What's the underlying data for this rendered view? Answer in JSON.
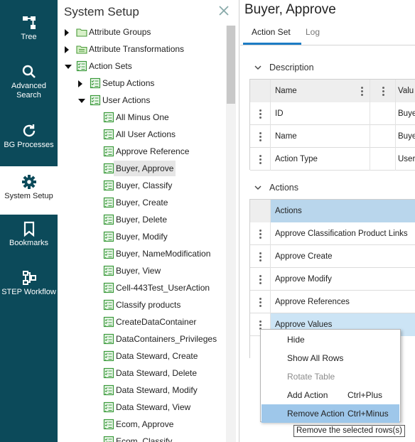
{
  "nav": {
    "items": [
      {
        "label": "Tree",
        "icon": "tree-icon"
      },
      {
        "label": "Advanced Search",
        "icon": "search-icon"
      },
      {
        "label": "BG Processes",
        "icon": "refresh-icon"
      },
      {
        "label": "System Setup",
        "icon": "gear-icon",
        "active": true
      },
      {
        "label": "Bookmarks",
        "icon": "bookmark-icon"
      },
      {
        "label": "STEP Workflow",
        "icon": "workflow-icon"
      }
    ]
  },
  "tree": {
    "title": "System Setup",
    "nodes": [
      {
        "label": "Attribute Groups",
        "state": "collapsed",
        "icon": "folder"
      },
      {
        "label": "Attribute Transformations",
        "state": "collapsed",
        "icon": "folder-list"
      },
      {
        "label": "Action Sets",
        "state": "expanded",
        "icon": "checklist"
      },
      {
        "label": "Setup Actions",
        "state": "collapsed",
        "icon": "checklist"
      },
      {
        "label": "User Actions",
        "state": "expanded",
        "icon": "checklist"
      },
      {
        "label": "All Minus One",
        "icon": "checklist"
      },
      {
        "label": "All User Actions",
        "icon": "checklist"
      },
      {
        "label": "Approve Reference",
        "icon": "checklist"
      },
      {
        "label": "Buyer, Approve",
        "icon": "checklist",
        "selected": true
      },
      {
        "label": "Buyer, Classify",
        "icon": "checklist"
      },
      {
        "label": "Buyer, Create",
        "icon": "checklist"
      },
      {
        "label": "Buyer, Delete",
        "icon": "checklist"
      },
      {
        "label": "Buyer, Modify",
        "icon": "checklist"
      },
      {
        "label": "Buyer, NameModification",
        "icon": "checklist"
      },
      {
        "label": "Buyer, View",
        "icon": "checklist"
      },
      {
        "label": "Cell-443Test_UserAction",
        "icon": "checklist"
      },
      {
        "label": "Classify products",
        "icon": "checklist"
      },
      {
        "label": "CreateDataContainer",
        "icon": "checklist"
      },
      {
        "label": "DataContainers_Privileges",
        "icon": "checklist"
      },
      {
        "label": "Data Steward, Create",
        "icon": "checklist"
      },
      {
        "label": "Data Steward, Delete",
        "icon": "checklist"
      },
      {
        "label": "Data Steward, Modify",
        "icon": "checklist"
      },
      {
        "label": "Data Steward, View",
        "icon": "checklist"
      },
      {
        "label": "Ecom, Approve",
        "icon": "checklist"
      },
      {
        "label": "Ecom, Classify",
        "icon": "checklist"
      }
    ]
  },
  "main": {
    "title": "Buyer, Approve",
    "tabs": [
      {
        "label": "Action Set"
      },
      {
        "label": "Log"
      }
    ],
    "description": {
      "heading": "Description",
      "columns": [
        "Name",
        "Valu"
      ],
      "rows": [
        {
          "name": "ID",
          "value": "Buye"
        },
        {
          "name": "Name",
          "value": "Buye"
        },
        {
          "name": "Action Type",
          "value": "User"
        }
      ]
    },
    "actions": {
      "heading": "Actions",
      "column": "Actions",
      "rows": [
        {
          "label": "Approve Classification Product Links"
        },
        {
          "label": "Approve Create"
        },
        {
          "label": "Approve Modify"
        },
        {
          "label": "Approve References"
        },
        {
          "label": "Approve Values"
        }
      ]
    }
  },
  "context_menu": {
    "items": [
      {
        "label": "Hide",
        "shortcut": ""
      },
      {
        "label": "Show All Rows",
        "shortcut": ""
      },
      {
        "label": "Rotate Table",
        "shortcut": "",
        "disabled": true
      },
      {
        "label": "Add Action",
        "shortcut": "Ctrl+Plus"
      },
      {
        "label": "Remove Action",
        "shortcut": "Ctrl+Minus",
        "hover": true
      }
    ]
  },
  "tooltip": "Remove the selected rows(s)",
  "colors": {
    "nav_bg": "#0c4a5a",
    "accent": "#1d7cc4",
    "menu_hover": "#9ec7ea",
    "checklist_icon": "#3a9a3a"
  }
}
